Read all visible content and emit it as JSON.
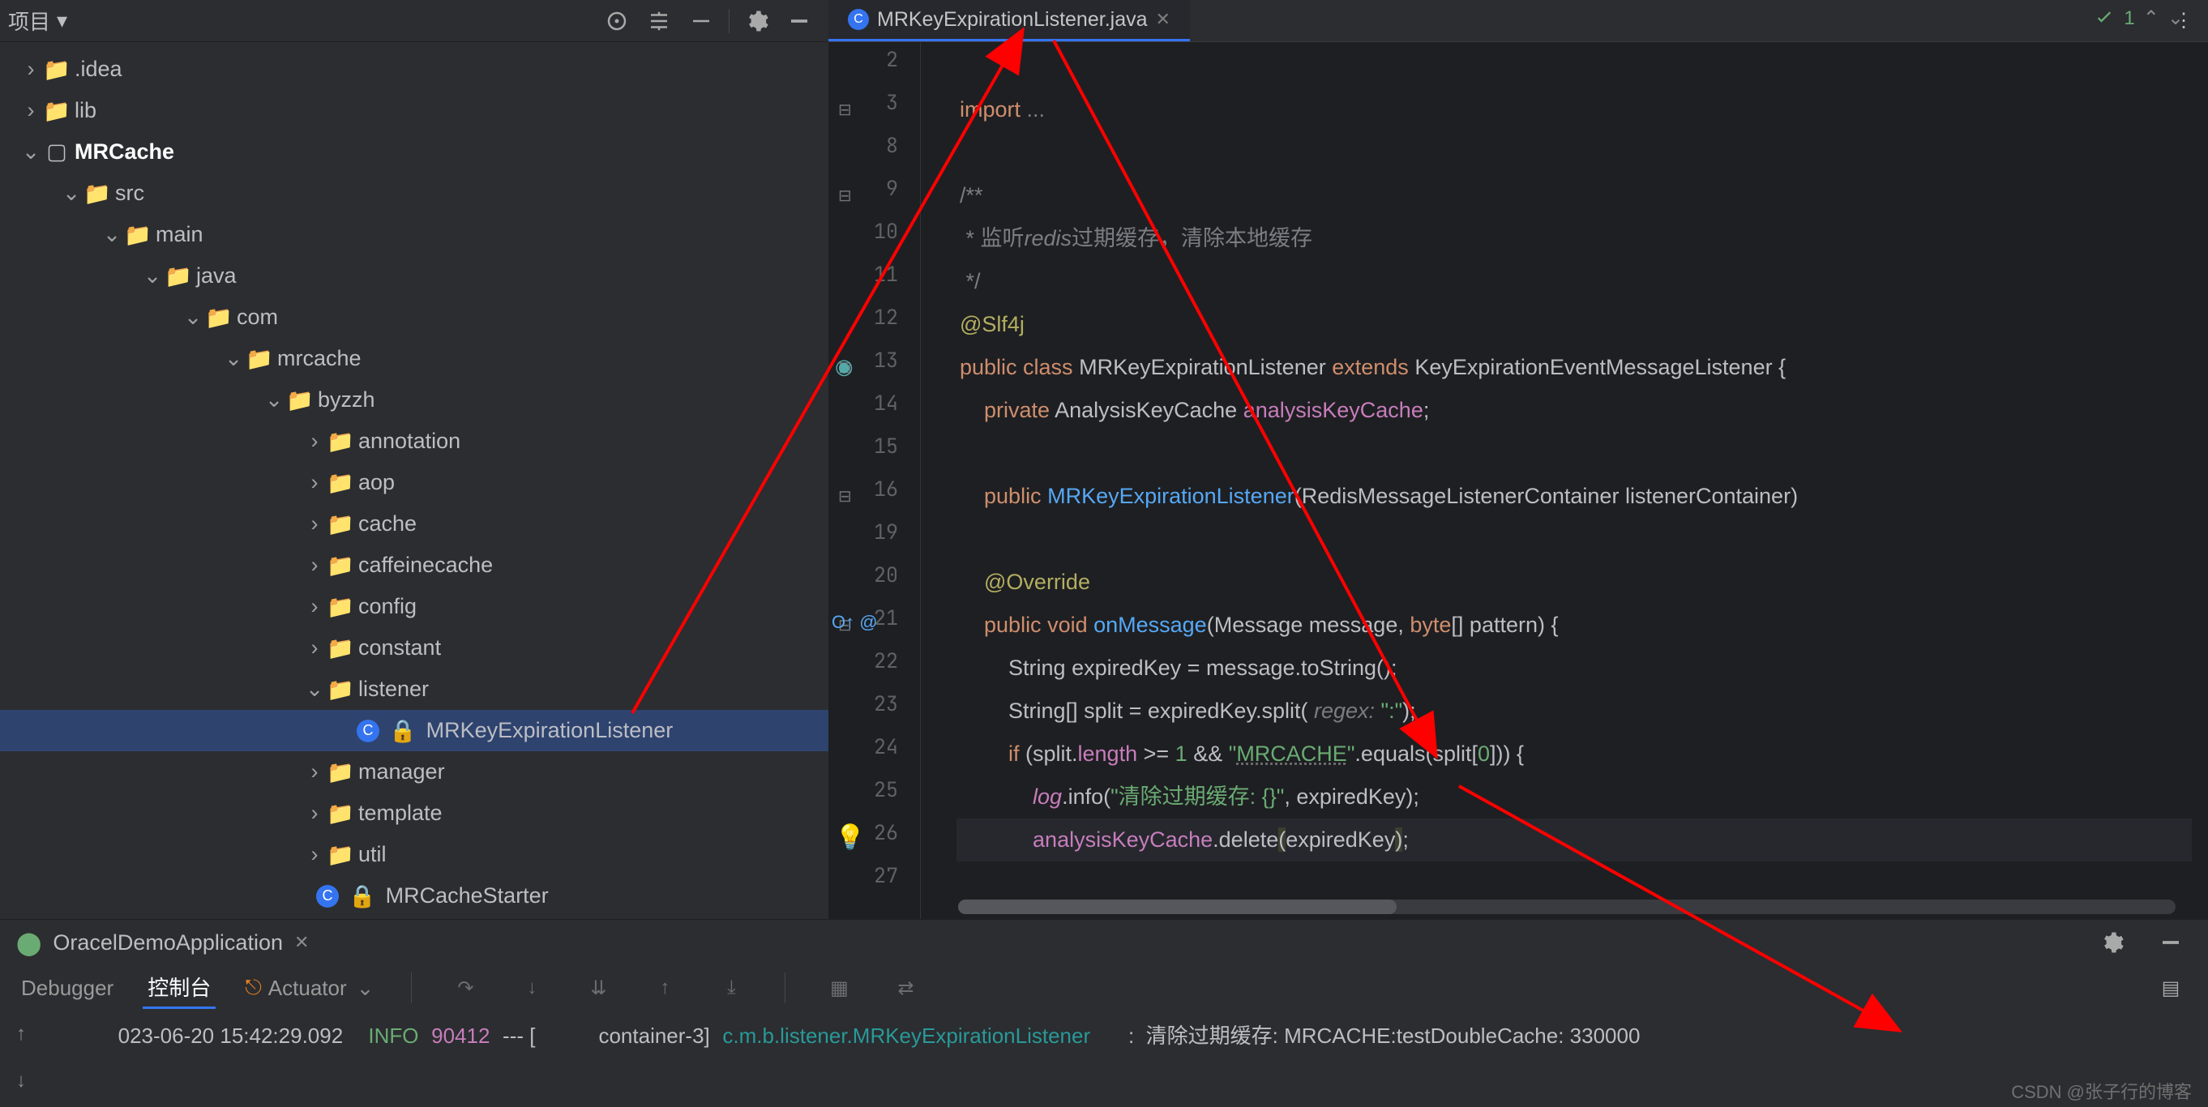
{
  "sidebar": {
    "title": "项目",
    "tree": {
      "idea": ".idea",
      "lib": "lib",
      "mrcache": "MRCache",
      "src": "src",
      "main": "main",
      "java": "java",
      "com": "com",
      "mrcache_pkg": "mrcache",
      "byzzh": "byzzh",
      "annotation": "annotation",
      "aop": "aop",
      "cache": "cache",
      "caffeinecache": "caffeinecache",
      "config": "config",
      "constant": "constant",
      "listener": "listener",
      "file_listener": "MRKeyExpirationListener",
      "manager": "manager",
      "template": "template",
      "util": "util",
      "starter": "MRCacheStarter"
    }
  },
  "tab": {
    "label": "MRKeyExpirationListener.java"
  },
  "inspections": {
    "count": "1"
  },
  "code": {
    "lines": [
      {
        "n": "2",
        "html": ""
      },
      {
        "n": "3",
        "html": "<span class='kw'>import</span> <span class='cmt'>...</span>"
      },
      {
        "n": "8",
        "html": ""
      },
      {
        "n": "9",
        "html": "<span class='cmt'>/**</span>"
      },
      {
        "n": "10",
        "html": "<span class='cmt'> * 监听<span style='font-style:italic'>redis</span>过期缓存，清除本地缓存</span>"
      },
      {
        "n": "11",
        "html": "<span class='cmt'> */</span>"
      },
      {
        "n": "12",
        "html": "<span class='ann'>@Slf4j</span>"
      },
      {
        "n": "13",
        "html": "<span class='kw'>public class</span> <span class='type'>MRKeyExpirationListener</span> <span class='kw'>extends</span> <span class='type'>KeyExpirationEventMessageListener</span> {"
      },
      {
        "n": "14",
        "html": "    <span class='kw'>private</span> <span class='type'>AnalysisKeyCache</span> <span class='fld'>analysisKeyCache</span>;"
      },
      {
        "n": "15",
        "html": ""
      },
      {
        "n": "16",
        "html": "    <span class='kw'>public</span> <span class='mname'>MRKeyExpirationListener</span>(<span class='type'>RedisMessageListenerContainer</span> <span class='param'>listenerContainer</span>)"
      },
      {
        "n": "19",
        "html": ""
      },
      {
        "n": "20",
        "html": "    <span class='ann'>@Override</span>"
      },
      {
        "n": "21",
        "html": "    <span class='kw'>public void</span> <span class='mname'>onMessage</span>(<span class='type'>Message</span> <span class='param'>message</span>, <span class='kw'>byte</span>[] <span class='param'>pattern</span>) {"
      },
      {
        "n": "22",
        "html": "        <span class='type'>String</span> <span class='param'>expiredKey</span> = message.toString();"
      },
      {
        "n": "23",
        "html": "        <span class='type'>String</span>[] <span class='param'>split</span> = expiredKey.split(<span class='hint'> regex: </span><span class='str'>\":\"</span>);"
      },
      {
        "n": "24",
        "html": "        <span class='kw'>if</span> (split.<span class='fld'>length</span> &gt;= <span class='str'>1</span> &amp;&amp; <span class='str'>\"<span class='underline'>MRCACHE</span>\"</span>.equals(split[<span class='str'>0</span>])) {"
      },
      {
        "n": "25",
        "html": "            <span class='kw2'>log</span>.info(<span class='str'>\"清除过期缓存: {}\"</span>, expiredKey);"
      },
      {
        "n": "26",
        "html": "            <span class='fld'>analysisKeyCache</span>.delete<span style='background:#3c3f2e'>(</span>expiredKey<span style='background:#3c3f2e'>)</span>;"
      },
      {
        "n": "27",
        "html": ""
      }
    ]
  },
  "run": {
    "title": "OracelDemoApplication",
    "tabs": {
      "debugger": "Debugger",
      "console": "控制台",
      "actuator": "Actuator"
    }
  },
  "log": {
    "ts": "023-06-20 15:42:29.092",
    "level": "INFO",
    "pid": "90412",
    "sep": "--- [",
    "thread": "container-3]",
    "cls": "c.m.b.listener.MRKeyExpirationListener",
    "msg": ":  清除过期缓存: MRCACHE:testDoubleCache: 330000"
  },
  "watermark": "CSDN @张子行的博客"
}
